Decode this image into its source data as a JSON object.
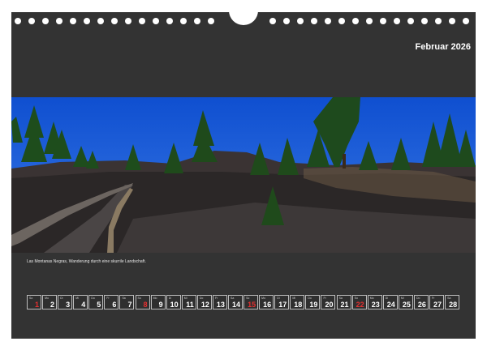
{
  "header": {
    "month_title": "Februar 2026"
  },
  "photo": {
    "caption": "Las Montanas Negras, Wanderung durch eine skurrile Landschaft.",
    "colors": {
      "sky": "#1a5ad6",
      "ground": "#2d2a2a",
      "tree": "#1e4d1c",
      "path": "#4a4545"
    }
  },
  "calendar": {
    "days": [
      {
        "dow": "So",
        "num": "1",
        "sunday": true
      },
      {
        "dow": "Mo",
        "num": "2"
      },
      {
        "dow": "Di",
        "num": "3"
      },
      {
        "dow": "Mi",
        "num": "4"
      },
      {
        "dow": "Do",
        "num": "5"
      },
      {
        "dow": "Fr",
        "num": "6"
      },
      {
        "dow": "Sa",
        "num": "7"
      },
      {
        "dow": "So",
        "num": "8",
        "sunday": true
      },
      {
        "dow": "Mo",
        "num": "9"
      },
      {
        "dow": "Di",
        "num": "10"
      },
      {
        "dow": "Mi",
        "num": "11"
      },
      {
        "dow": "Do",
        "num": "12"
      },
      {
        "dow": "Fr",
        "num": "13"
      },
      {
        "dow": "Sa",
        "num": "14"
      },
      {
        "dow": "So",
        "num": "15",
        "sunday": true
      },
      {
        "dow": "Mo",
        "num": "16"
      },
      {
        "dow": "Di",
        "num": "17"
      },
      {
        "dow": "Mi",
        "num": "18"
      },
      {
        "dow": "Do",
        "num": "19"
      },
      {
        "dow": "Fr",
        "num": "20"
      },
      {
        "dow": "Sa",
        "num": "21"
      },
      {
        "dow": "So",
        "num": "22",
        "sunday": true
      },
      {
        "dow": "Mo",
        "num": "23"
      },
      {
        "dow": "Di",
        "num": "24"
      },
      {
        "dow": "Mi",
        "num": "25"
      },
      {
        "dow": "Do",
        "num": "26"
      },
      {
        "dow": "Fr",
        "num": "27"
      },
      {
        "dow": "Sa",
        "num": "28"
      }
    ]
  }
}
